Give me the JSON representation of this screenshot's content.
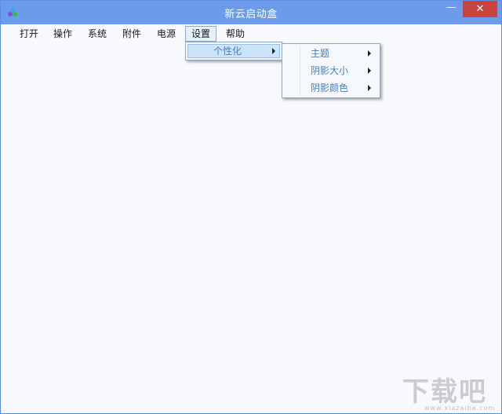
{
  "window": {
    "title": "新云启动盒",
    "minimize_glyph": "—",
    "close_glyph": "✕"
  },
  "app_icon": "app-logo-icon",
  "menubar": {
    "items": [
      {
        "label": "打开"
      },
      {
        "label": "操作"
      },
      {
        "label": "系统"
      },
      {
        "label": "附件"
      },
      {
        "label": "电源"
      },
      {
        "label": "设置"
      },
      {
        "label": "帮助"
      }
    ],
    "active": "设置"
  },
  "dropdown": {
    "items": [
      {
        "label": "个性化",
        "has_submenu": true
      }
    ]
  },
  "submenu": {
    "items": [
      {
        "label": "主题",
        "has_submenu": true
      },
      {
        "label": "阴影大小",
        "has_submenu": true
      },
      {
        "label": "阴影颜色",
        "has_submenu": true
      }
    ]
  },
  "watermark": {
    "text": "下载吧",
    "url": "www.xiazaiba.com"
  },
  "colors": {
    "titlebar": "#6c9bec",
    "close_button": "#c7443f",
    "window_bg": "#f7f9fc",
    "highlight": "#cce4f9",
    "menu_text": "#4d7fb5"
  }
}
